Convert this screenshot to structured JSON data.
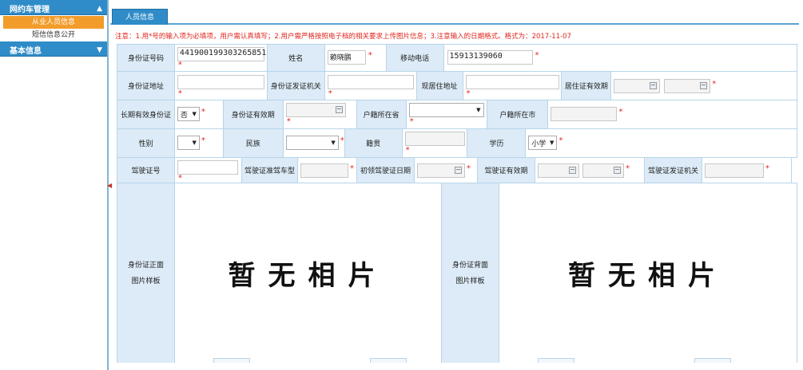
{
  "sidebar": {
    "sections": [
      {
        "title": "网约车管理",
        "arrow": "▲",
        "items": [
          "从业人员信息",
          "短信信息公开"
        ]
      },
      {
        "title": "基本信息",
        "arrow": "▼"
      }
    ],
    "collapse_glyph": "◀"
  },
  "tab": {
    "label": "人员信息"
  },
  "notice": "注意：1.用*号的输入项为必填项，用户需认真填写；2.用户需严格按照电子档的相关要求上传图片信息；3.注意输入的日期格式。格式为：2017-11-07",
  "required_mark": "*",
  "form": {
    "id_number": {
      "label": "身份证号码",
      "value": "441900199303265851"
    },
    "name": {
      "label": "姓名",
      "value": "赖晓鹏"
    },
    "mobile": {
      "label": "移动电话",
      "value": "15913139060"
    },
    "id_address": {
      "label": "身份证地址",
      "value": ""
    },
    "id_issuer": {
      "label": "身份证发证机关",
      "value": ""
    },
    "current_address": {
      "label": "现居住地址",
      "value": ""
    },
    "residence_permit_validity": {
      "label": "居住证有效期",
      "value": ""
    },
    "long_term_id": {
      "label": "长期有效身份证",
      "value": "否"
    },
    "id_validity": {
      "label": "身份证有效期",
      "value": ""
    },
    "hukou_province": {
      "label": "户籍所在省",
      "value": ""
    },
    "hukou_city": {
      "label": "户籍所在市",
      "value": ""
    },
    "gender": {
      "label": "性别",
      "value": ""
    },
    "ethnicity": {
      "label": "民族",
      "value": ""
    },
    "native_place": {
      "label": "籍贯",
      "value": ""
    },
    "education": {
      "label": "学历",
      "value": "小学"
    },
    "license_no": {
      "label": "驾驶证号",
      "value": ""
    },
    "license_class": {
      "label": "驾驶证准驾车型",
      "value": ""
    },
    "first_license_date": {
      "label": "初领驾驶证日期",
      "value": ""
    },
    "license_validity": {
      "label": "驾驶证有效期",
      "value": ""
    },
    "license_issuer": {
      "label": "驾驶证发证机关",
      "value": ""
    }
  },
  "photos": [
    {
      "label_line1": "身份证正面",
      "label_line2": "图片样板",
      "placeholder": "暂无相片"
    },
    {
      "label_line1": "身份证背面",
      "label_line2": "图片样板",
      "placeholder": "暂无相片"
    }
  ],
  "colors": {
    "accent": "#2f8cc8",
    "active_item": "#f29c2b",
    "label_bg": "#dcebf7",
    "required": "#e0261c",
    "border": "#b7d5ea"
  }
}
